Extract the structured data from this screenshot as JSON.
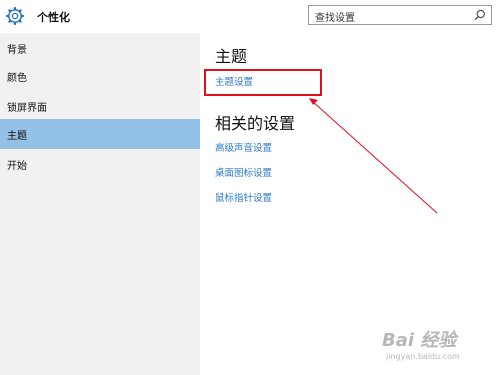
{
  "header": {
    "title": "个性化",
    "icon": "gear-icon",
    "search": {
      "value": "查找设置",
      "icon": "search-icon"
    }
  },
  "sidebar": {
    "items": [
      {
        "label": "背景",
        "selected": false
      },
      {
        "label": "颜色",
        "selected": false
      },
      {
        "label": "锁屏界面",
        "selected": false
      },
      {
        "label": "主题",
        "selected": true
      },
      {
        "label": "开始",
        "selected": false
      }
    ],
    "selected_color": "#94c1e6"
  },
  "main": {
    "theme_title": "主题",
    "theme_settings_link": "主题设置",
    "related_title": "相关的设置",
    "related_links": [
      "高级声音设置",
      "桌面图标设置",
      "鼠标指针设置"
    ],
    "link_color": "#2c78c8"
  },
  "annotation": {
    "color": "#e0101d"
  },
  "watermark": {
    "text": "Bai 经验",
    "sub": "jingyan.baidu.com"
  }
}
